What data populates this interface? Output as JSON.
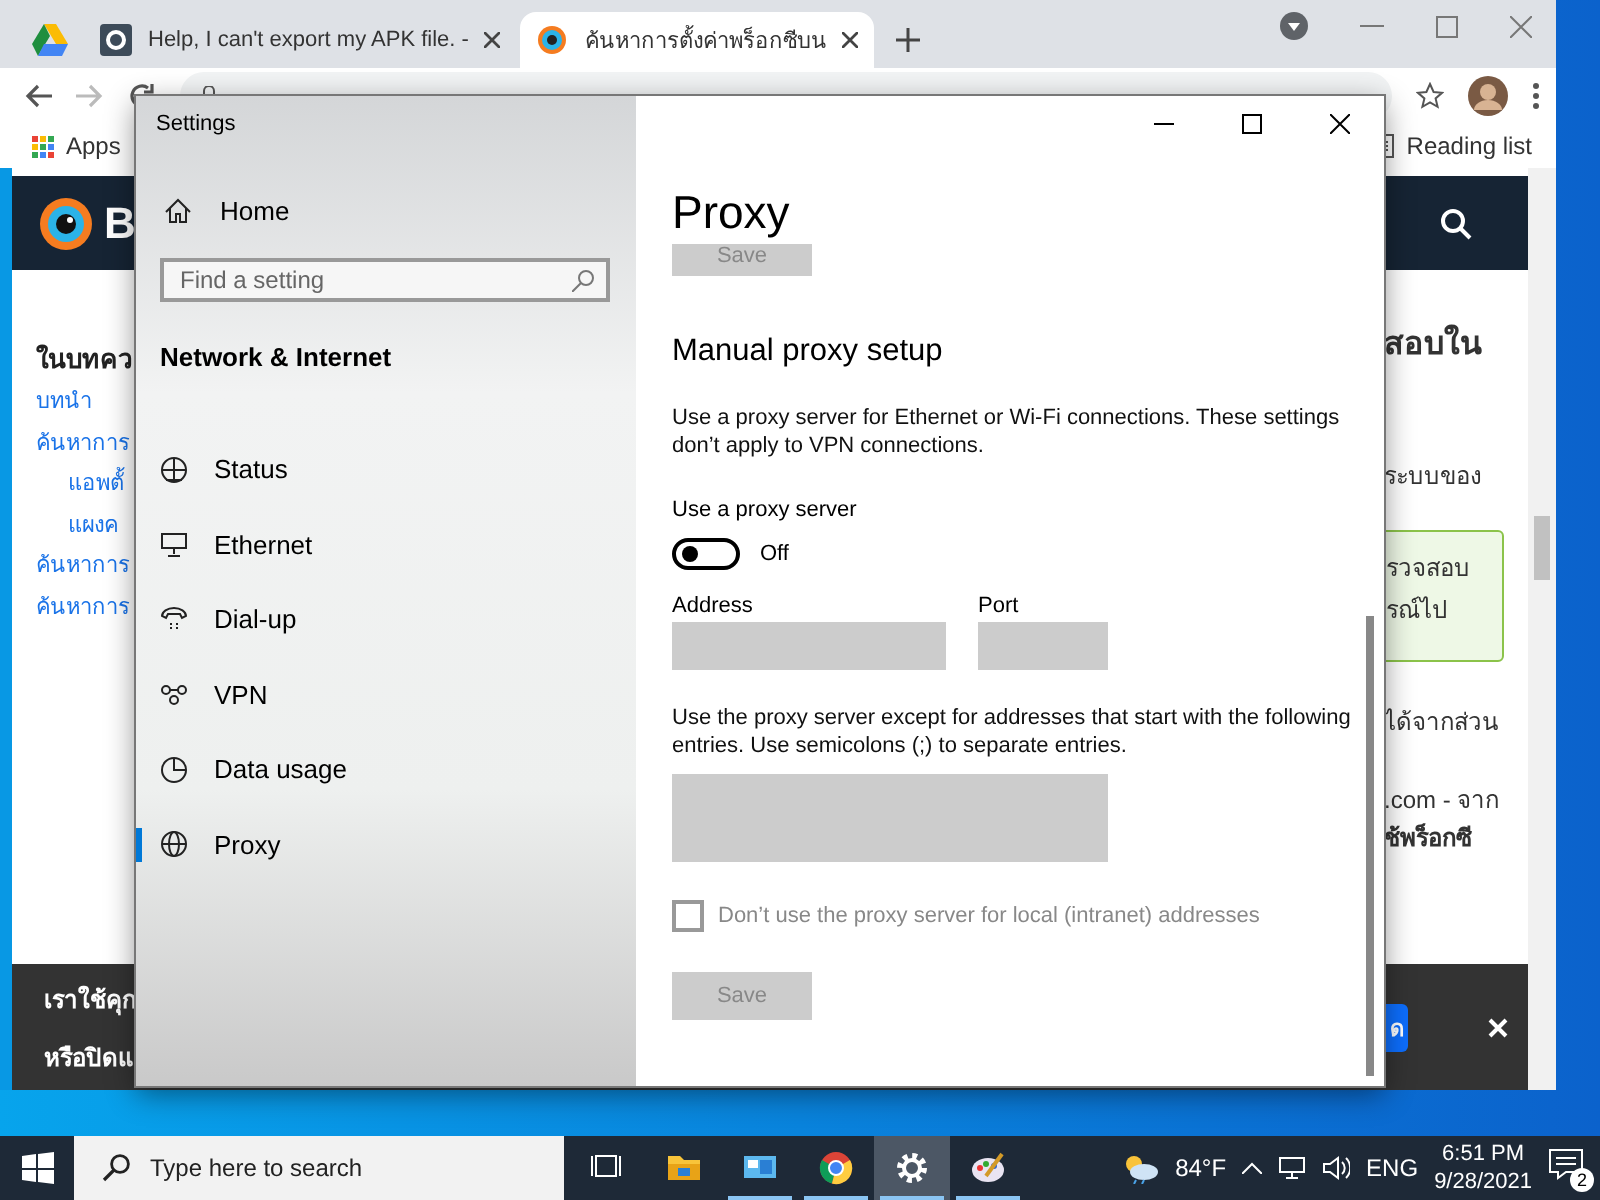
{
  "browser": {
    "tabs": [
      {
        "title": "Help, I can't export my APK file. -",
        "selected": false
      },
      {
        "title": "ค้นหาการตั้งค่าพร็อกซีบน",
        "selected": true
      }
    ],
    "bookmarks": [
      "Apps",
      "Reading list"
    ],
    "page": {
      "logo_letter": "B",
      "left_links": [
        {
          "text": "ในบทคว",
          "kind": "heading"
        },
        {
          "text": "บทนำ",
          "kind": "link"
        },
        {
          "text": "ค้นหาการ",
          "kind": "link"
        },
        {
          "text": "แอพตั้",
          "kind": "sublink"
        },
        {
          "text": "แผงค",
          "kind": "sublink"
        },
        {
          "text": "ค้นหาการ",
          "kind": "link"
        },
        {
          "text": "ค้นหาการ",
          "kind": "link"
        }
      ],
      "right_blocks": [
        {
          "kind": "heading",
          "lines": [
            "สอบใน"
          ]
        },
        {
          "kind": "text",
          "lines": [
            "ระบบของ"
          ]
        },
        {
          "kind": "callout",
          "lines": [
            "รวจสอบ",
            "รณ์ไป"
          ]
        },
        {
          "kind": "text",
          "lines": [
            "ได้จากส่วน"
          ]
        },
        {
          "kind": "text",
          "lines": [
            ".com - จาก"
          ]
        },
        {
          "kind": "bold",
          "lines": [
            "ช้พร็อกซี"
          ]
        }
      ],
      "cookie_lines": [
        "เราใช้คุก",
        "หรือปิดแ"
      ],
      "cookie_button": "ด"
    }
  },
  "settings": {
    "title": "Settings",
    "home": "Home",
    "search_placeholder": "Find a setting",
    "section": "Network & Internet",
    "nav": [
      {
        "label": "Status",
        "kind": "status",
        "selected": false
      },
      {
        "label": "Ethernet",
        "kind": "ethernet",
        "selected": false
      },
      {
        "label": "Dial-up",
        "kind": "dialup",
        "selected": false
      },
      {
        "label": "VPN",
        "kind": "vpn",
        "selected": false
      },
      {
        "label": "Data usage",
        "kind": "data",
        "selected": false
      },
      {
        "label": "Proxy",
        "kind": "proxy",
        "selected": true
      }
    ],
    "page_title": "Proxy",
    "top_save": "Save",
    "heading": "Manual proxy setup",
    "description": "Use a proxy server for Ethernet or Wi-Fi connections. These settings don’t apply to VPN connections.",
    "toggle": {
      "label": "Use a proxy server",
      "on": false,
      "state_text": "Off"
    },
    "address_label": "Address",
    "port_label": "Port",
    "exceptions_text": "Use the proxy server except for addresses that start with the following entries. Use semicolons (;) to separate entries.",
    "bypass_local": {
      "label": "Don’t use the proxy server for local (intranet) addresses",
      "checked": false,
      "disabled": true
    },
    "save": "Save"
  },
  "taskbar": {
    "search_placeholder": "Type here to search",
    "apps": [
      {
        "kind": "taskview",
        "running": false,
        "selected": false
      },
      {
        "kind": "explorer",
        "running": false,
        "selected": false
      },
      {
        "kind": "monitor",
        "running": true,
        "selected": false
      },
      {
        "kind": "chrome",
        "running": true,
        "selected": false
      },
      {
        "kind": "settings",
        "running": true,
        "selected": true
      },
      {
        "kind": "paint",
        "running": true,
        "selected": false
      }
    ],
    "temperature": "84°F",
    "language": "ENG",
    "time": "6:51 PM",
    "date": "9/28/2021",
    "notification_count": "2"
  }
}
